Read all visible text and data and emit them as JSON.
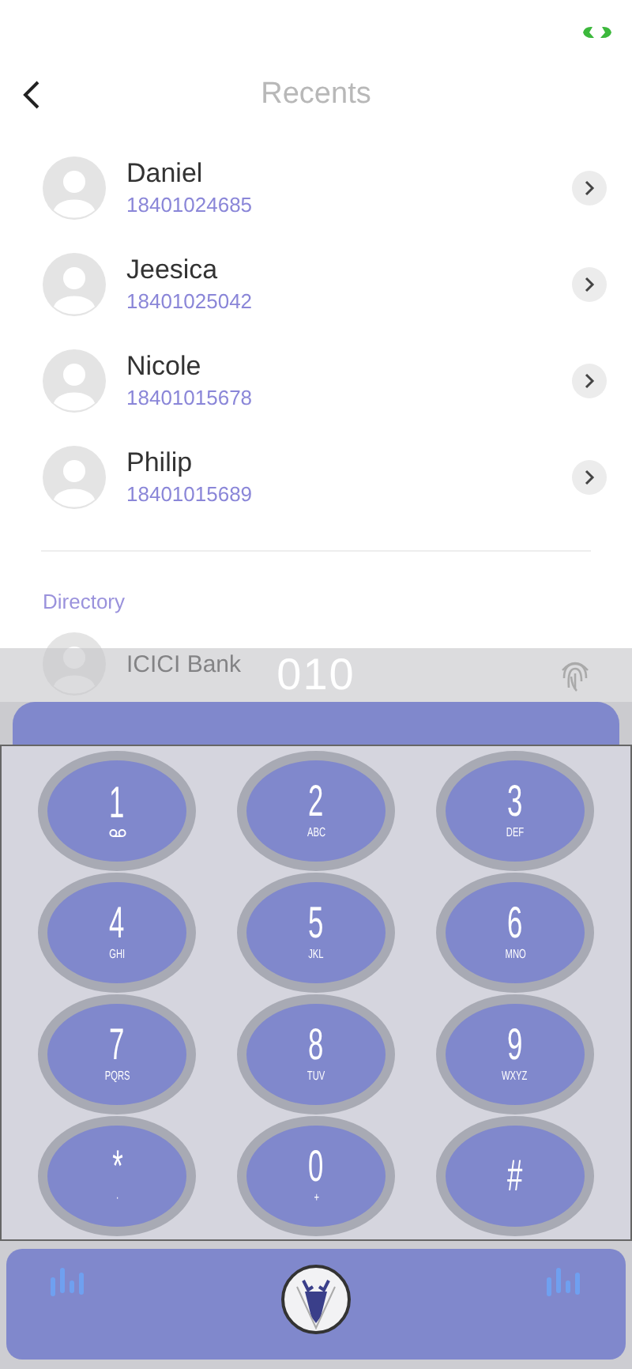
{
  "header": {
    "title": "Recents"
  },
  "contacts": [
    {
      "name": "Daniel",
      "number": "18401024685"
    },
    {
      "name": "Jeesica",
      "number": "18401025042"
    },
    {
      "name": "Nicole",
      "number": "18401015678"
    },
    {
      "name": "Philip",
      "number": "18401015689"
    }
  ],
  "directory": {
    "label": "Directory",
    "entries": [
      {
        "name": "ICICI Bank"
      }
    ]
  },
  "dialer": {
    "input": "010",
    "keys": [
      {
        "digit": "1",
        "kind": "voicemail"
      },
      {
        "digit": "2",
        "letters": "ABC",
        "kind": "letters"
      },
      {
        "digit": "3",
        "letters": "DEF",
        "kind": "letters"
      },
      {
        "digit": "4",
        "letters": "GHI",
        "kind": "letters"
      },
      {
        "digit": "5",
        "letters": "JKL",
        "kind": "letters"
      },
      {
        "digit": "6",
        "letters": "MNO",
        "kind": "letters"
      },
      {
        "digit": "7",
        "letters": "PQRS",
        "kind": "letters"
      },
      {
        "digit": "8",
        "letters": "TUV",
        "kind": "letters"
      },
      {
        "digit": "9",
        "letters": "WXYZ",
        "kind": "letters"
      },
      {
        "digit": "*",
        "letters": "·",
        "kind": "letters"
      },
      {
        "digit": "0",
        "letters": "+",
        "kind": "letters"
      },
      {
        "digit": "#",
        "kind": "plain"
      }
    ]
  }
}
